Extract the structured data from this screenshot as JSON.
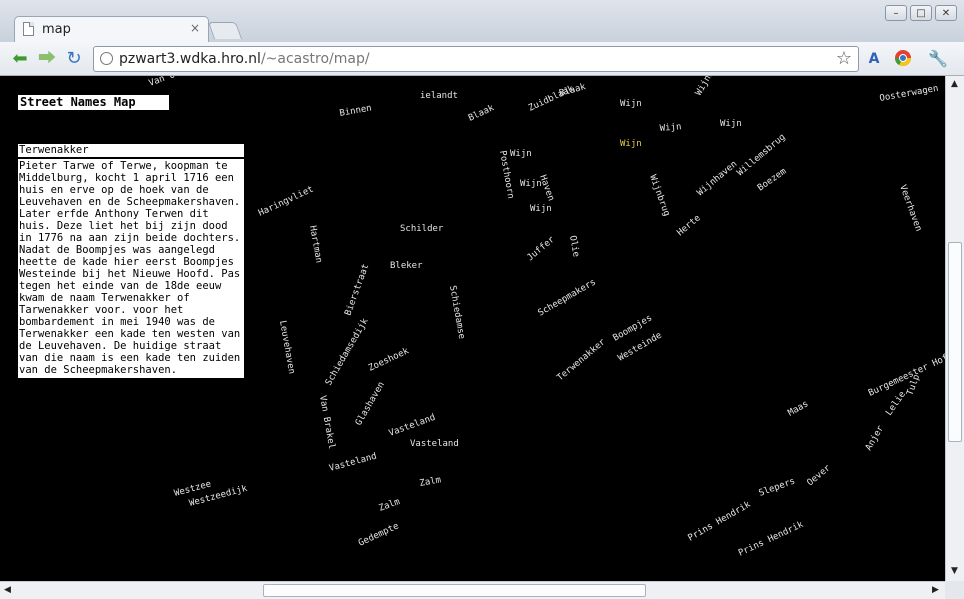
{
  "window": {
    "tab_title": "map",
    "tab_close": "×",
    "controls": {
      "minimize": "–",
      "maximize": "□",
      "close": "✕"
    }
  },
  "toolbar": {
    "back_icon": "back-arrow-icon",
    "forward_icon": "forward-arrow-icon",
    "reload_icon": "reload-icon",
    "url_host": "pzwart3.wdka.hro.nl",
    "url_path": "/~acastro/map/",
    "bookmark_icon": "star-icon",
    "ext1_icon": "translate-icon",
    "ext2_icon": "chrome-icon",
    "menu_icon": "wrench-icon"
  },
  "page": {
    "title": "Street Names Map",
    "selected_street": {
      "name": "Terwenakker",
      "description": "Pieter Tarwe of Terwe, koopman te Middelburg, kocht 1 april 1716 een huis en erve op de hoek van de Leuvehaven en de Scheepmakershaven. Later erfde Anthony Terwen dit huis. Deze liet het bij zijn dood in 1776 na aan zijn beide dochters. Nadat de Boompjes was aangelegd heette de kade hier eerst Boompjes Westeinde bij het Nieuwe Hoofd. Pas tegen het einde van de 18de eeuw kwam de naam Terwenakker of Tarwenakker voor. voor het bombardement in mei 1940 was de Terwenakker een kade ten westen van de Leuvehaven. De huidige straat van die naam is een kade ten zuiden van de Scheepmakershaven."
    },
    "colors": {
      "background": "#000000",
      "label": "#e6e6e6",
      "highlight": "#e8d34a"
    },
    "map_labels": [
      "Van Oldenbarnevelt",
      "Binnen",
      "ielandt",
      "Blaak",
      "Blaak",
      "Wijn",
      "Wijn",
      "Wijnhaven",
      "Oosterwagen",
      "Zuidblaak",
      "Posthoorn",
      "Haven",
      "Wijn",
      "Wijn",
      "Wijn",
      "Wijnhaven",
      "Juffer",
      "Schilder",
      "Bleker",
      "Schiedamse",
      "Scheepmakers",
      "Terwenakker",
      "Boompjes",
      "Westeinde",
      "Vasteland",
      "Vasteland",
      "Zalm",
      "Zalm",
      "Westzee",
      "Prins Hendrik",
      "Prins Hendrik",
      "Burgemeester Hoffman",
      "Maas",
      "Oever",
      "Tulp",
      "Lelie",
      "Anjer",
      "Gedempte",
      "Zoeshoek",
      "Haringvliet",
      "Wijnbrug",
      "Herte",
      "Olie",
      "Schiedamsedijk",
      "Leuvehaven",
      "Bierstraat",
      "Hartman",
      "Van Brakel",
      "Glashaven",
      "Wijn",
      "Vasteland",
      "Westzeedijk",
      "Willemsbrug",
      "Boezem",
      "Veerhaven",
      "Slepers",
      "Wijn"
    ]
  }
}
